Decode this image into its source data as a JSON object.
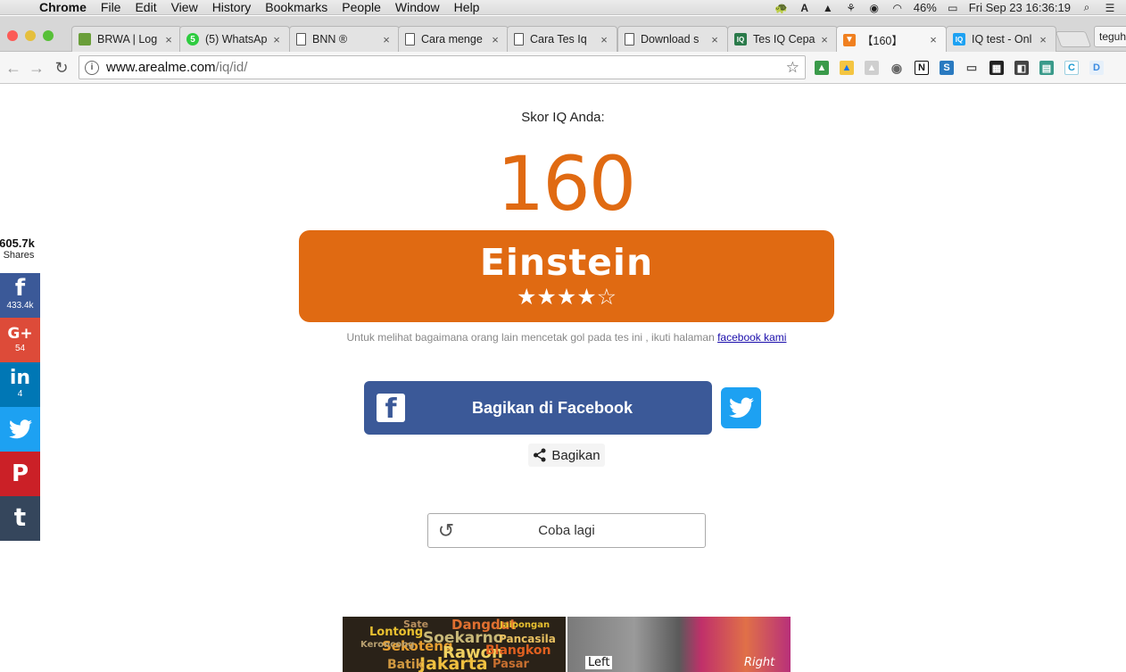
{
  "menubar": {
    "app": "Chrome",
    "items": [
      "File",
      "Edit",
      "View",
      "History",
      "Bookmarks",
      "People",
      "Window",
      "Help"
    ],
    "battery": "46%",
    "clock": "Fri Sep 23  16:36:19"
  },
  "tabs": [
    {
      "title": "BRWA | Log",
      "favicon": "brwa-icon",
      "color": "#6a9e3a"
    },
    {
      "title": "(5) WhatsAp",
      "favicon": "whatsapp-icon",
      "color": "#2ecc40"
    },
    {
      "title": "BNN ®",
      "favicon": "page-icon",
      "color": "#ffffff"
    },
    {
      "title": "Cara menge",
      "favicon": "page-icon",
      "color": "#ffffff"
    },
    {
      "title": "Cara Tes Iq",
      "favicon": "page-icon",
      "color": "#ffffff"
    },
    {
      "title": "Download s",
      "favicon": "page-icon",
      "color": "#ffffff"
    },
    {
      "title": "Tes IQ Cepa",
      "favicon": "iq-icon",
      "color": "#2a7a4a"
    },
    {
      "title": "【160】",
      "favicon": "fox-icon",
      "color": "#f08020"
    },
    {
      "title": "IQ test - Onl",
      "favicon": "iq-icon",
      "color": "#1da1f2"
    }
  ],
  "profile": "teguh",
  "address": {
    "host": "www.arealme.com",
    "path": "/iq/id/"
  },
  "page": {
    "score_label": "Skor IQ Anda:",
    "score_value": "160",
    "result_title": "Einstein",
    "result_stars": "★★★★☆",
    "rating": 4,
    "rating_max": 5,
    "fb_note_text": "Untuk melihat bagaimana orang lain mencetak gol pada tes ini , ikuti halaman ",
    "fb_note_link": "facebook kami",
    "fb_share_label": "Bagikan di Facebook",
    "share_label": "Bagikan",
    "retry_label": "Coba lagi"
  },
  "sidebar": {
    "total_count": "605.7k",
    "total_label": "Shares",
    "buttons": [
      {
        "name": "facebook",
        "glyph": "f",
        "count": "433.4k",
        "color": "#3b5998"
      },
      {
        "name": "google-plus",
        "glyph": "G+",
        "count": "54",
        "color": "#dd4b39"
      },
      {
        "name": "linkedin",
        "glyph": "in",
        "count": "4",
        "color": "#0077b5"
      },
      {
        "name": "twitter",
        "glyph": "",
        "count": "",
        "color": "#1da1f2"
      },
      {
        "name": "pinterest",
        "glyph": "P",
        "count": "",
        "color": "#cb2027"
      },
      {
        "name": "tumblr",
        "glyph": "t",
        "count": "",
        "color": "#35465c"
      }
    ]
  },
  "thumbnails": {
    "thumb1_words": [
      "Lontong",
      "Dangdut",
      "Soekarno",
      "Sekoteng",
      "Rawon",
      "Jakarta",
      "Pancasila",
      "Blangkon",
      "Batik",
      "Pasar",
      "Keroncong",
      "Sate",
      "Jaipongan"
    ],
    "thumb2_left": "Left",
    "thumb2_right": "Right"
  }
}
